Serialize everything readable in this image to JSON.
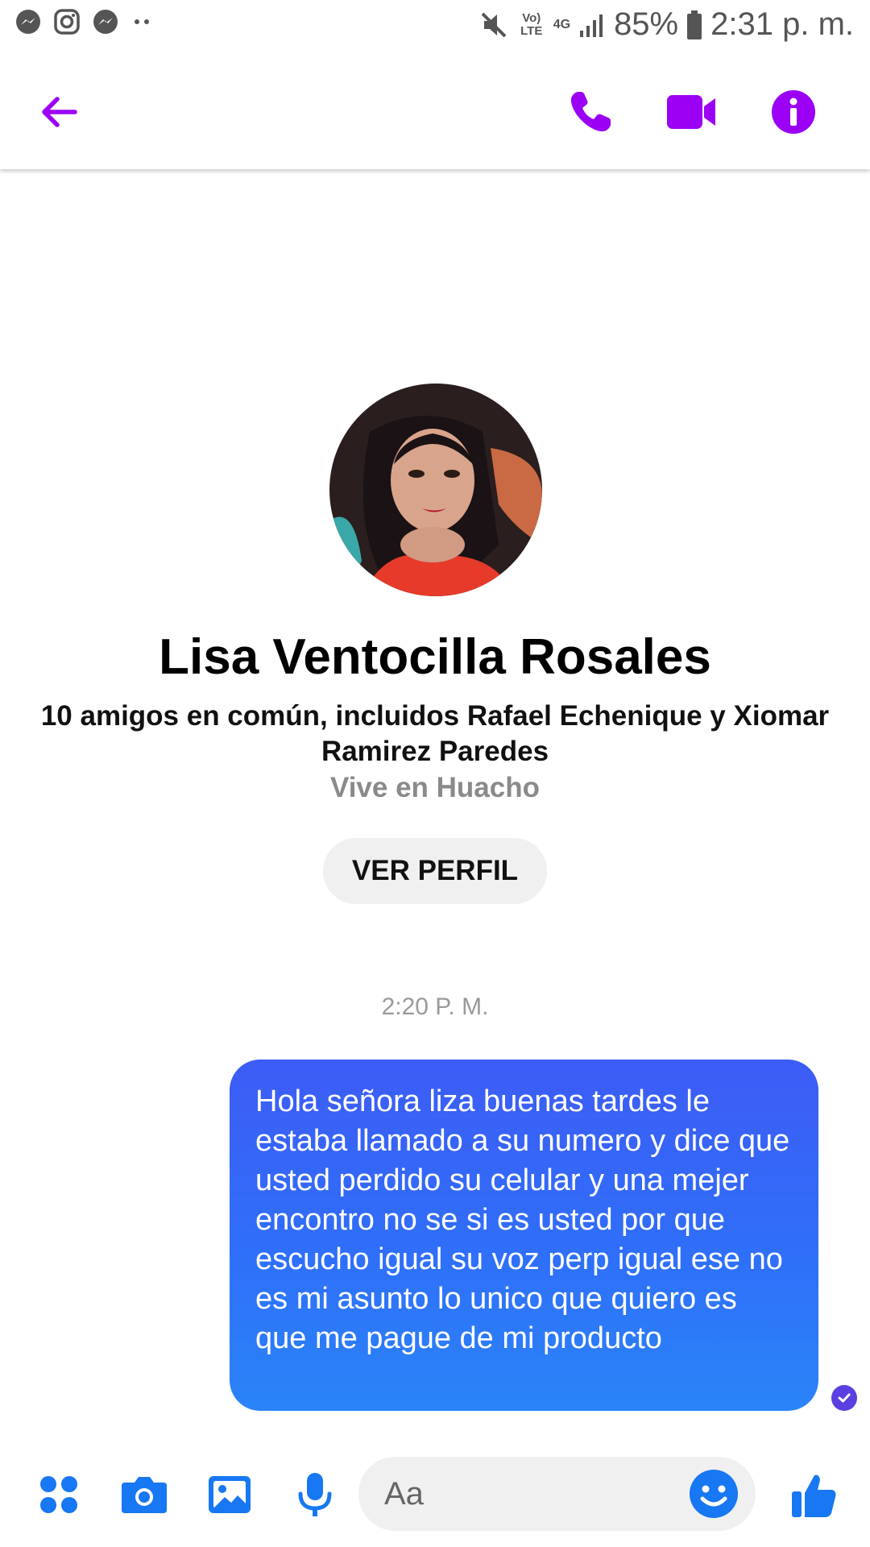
{
  "status_bar": {
    "battery": "85%",
    "time": "2:31 p. m.",
    "network": "4G",
    "volte": "Vo) LTE"
  },
  "header": {
    "accent_color": "#9b00f5"
  },
  "profile": {
    "name": "Lisa Ventocilla Rosales",
    "mutual_friends": "10 amigos en común, incluidos Rafael Echenique y Xiomar Ramirez Paredes",
    "location": "Vive en Huacho",
    "view_profile_label": "VER PERFIL"
  },
  "conversation": {
    "timestamp": "2:20 P. M.",
    "messages": [
      {
        "sender": "me",
        "text": "Hola señora liza buenas tardes le estaba llamado a su numero y dice que usted perdido su celular y una mejer encontro no se si es usted por que escucho igual su voz perp igual ese no es mi asunto lo unico que quiero es que me pague de mi producto"
      }
    ]
  },
  "composer": {
    "placeholder": "Aa",
    "icon_color": "#1877f2"
  }
}
